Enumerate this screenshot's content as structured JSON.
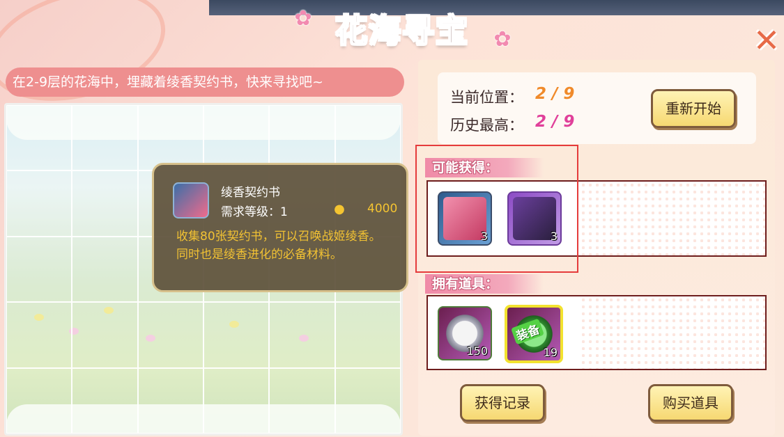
{
  "title": "花海寻宝",
  "hint": "在2-9层的花海中，埋藏着绫香契约书，快来寻找吧~",
  "tooltip": {
    "name": "绫香契约书",
    "level": "需求等级：1",
    "cost": "4000",
    "description": "收集80张契约书，可以召唤战姬绫香。同时也是绫香进化的必备材料。"
  },
  "position": {
    "current_label": "当前位置：",
    "current_value": "2 / 9",
    "best_label": "历史最高：",
    "best_value": "2 / 9"
  },
  "buttons": {
    "restart": "重新开始",
    "history": "获得记录",
    "buy": "购买道具"
  },
  "sections": {
    "possible": "可能获得：",
    "owned": "拥有道具："
  },
  "possible_items": [
    {
      "icon": "ayaka-contract-icon",
      "count": "3"
    },
    {
      "icon": "dark-girl-contract-icon",
      "count": "3"
    }
  ],
  "owned_items": [
    {
      "icon": "compass-icon",
      "count": "150"
    },
    {
      "icon": "equip-magnifier-icon",
      "count": "19",
      "tag": "装备"
    }
  ],
  "colors": {
    "accent_pink": "#ee8f8f",
    "current_value": "#f08a2a",
    "best_value": "#e0409a",
    "highlight": "#e53b3b"
  }
}
